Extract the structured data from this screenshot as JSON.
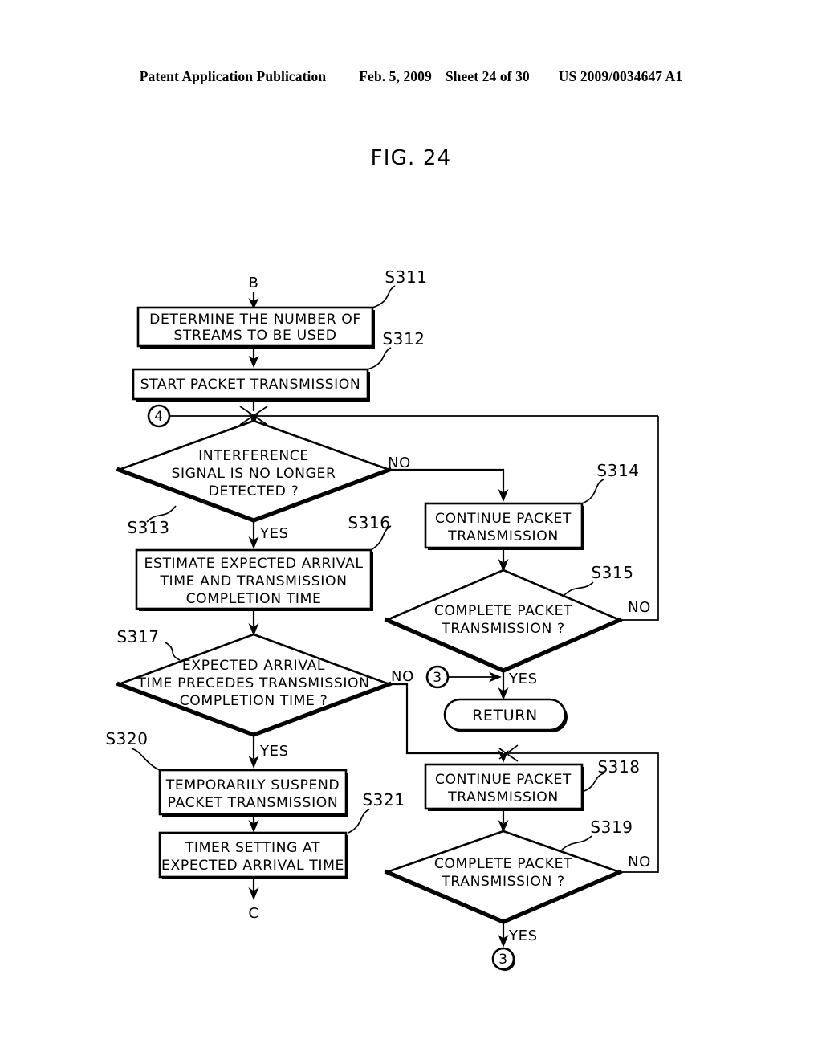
{
  "header": {
    "publication": "Patent Application Publication",
    "date": "Feb. 5, 2009",
    "sheet": "Sheet 24 of 30",
    "patent_number": "US 2009/0034647 A1"
  },
  "figure": {
    "title": "FIG. 24"
  },
  "flowchart": {
    "entry_connector": "B",
    "exit_connector": "C",
    "nodes": {
      "s311": {
        "id": "S311",
        "text_line1": "DETERMINE THE NUMBER OF",
        "text_line2": "STREAMS TO BE USED",
        "shape": "process"
      },
      "s312": {
        "id": "S312",
        "text_line1": "START PACKET TRANSMISSION",
        "shape": "process"
      },
      "s313": {
        "id": "S313",
        "text_line1": "INTERFERENCE",
        "text_line2": "SIGNAL IS NO LONGER",
        "text_line3": "DETECTED ?",
        "shape": "decision"
      },
      "s314": {
        "id": "S314",
        "text_line1": "CONTINUE PACKET",
        "text_line2": "TRANSMISSION",
        "shape": "process"
      },
      "s315": {
        "id": "S315",
        "text_line1": "COMPLETE PACKET",
        "text_line2": "TRANSMISSION ?",
        "shape": "decision"
      },
      "s316": {
        "id": "S316",
        "text_line1": "ESTIMATE EXPECTED ARRIVAL",
        "text_line2": "TIME AND TRANSMISSION",
        "text_line3": "COMPLETION TIME",
        "shape": "process"
      },
      "s317": {
        "id": "S317",
        "text_line1": "EXPECTED ARRIVAL",
        "text_line2": "TIME PRECEDES TRANSMISSION",
        "text_line3": "COMPLETION TIME ?",
        "shape": "decision"
      },
      "s318": {
        "id": "S318",
        "text_line1": "CONTINUE PACKET",
        "text_line2": "TRANSMISSION",
        "shape": "process"
      },
      "s319": {
        "id": "S319",
        "text_line1": "COMPLETE PACKET",
        "text_line2": "TRANSMISSION ?",
        "shape": "decision"
      },
      "s320": {
        "id": "S320",
        "text_line1": "TEMPORARILY SUSPEND",
        "text_line2": "PACKET TRANSMISSION",
        "shape": "process"
      },
      "s321": {
        "id": "S321",
        "text_line1": "TIMER SETTING AT",
        "text_line2": "EXPECTED ARRIVAL TIME",
        "shape": "process"
      },
      "return": {
        "text_line1": "RETURN",
        "shape": "terminator"
      }
    },
    "connectors": {
      "circle_4": "4",
      "circle_3_mid": "3",
      "circle_3_bottom": "3"
    },
    "branch_labels": {
      "s313_no": "NO",
      "s313_yes": "YES",
      "s315_no": "NO",
      "s315_yes": "YES",
      "s317_no": "NO",
      "s317_yes": "YES",
      "s319_no": "NO",
      "s319_yes": "YES"
    }
  },
  "colors": {
    "ink": "#000000",
    "paper": "#ffffff"
  }
}
